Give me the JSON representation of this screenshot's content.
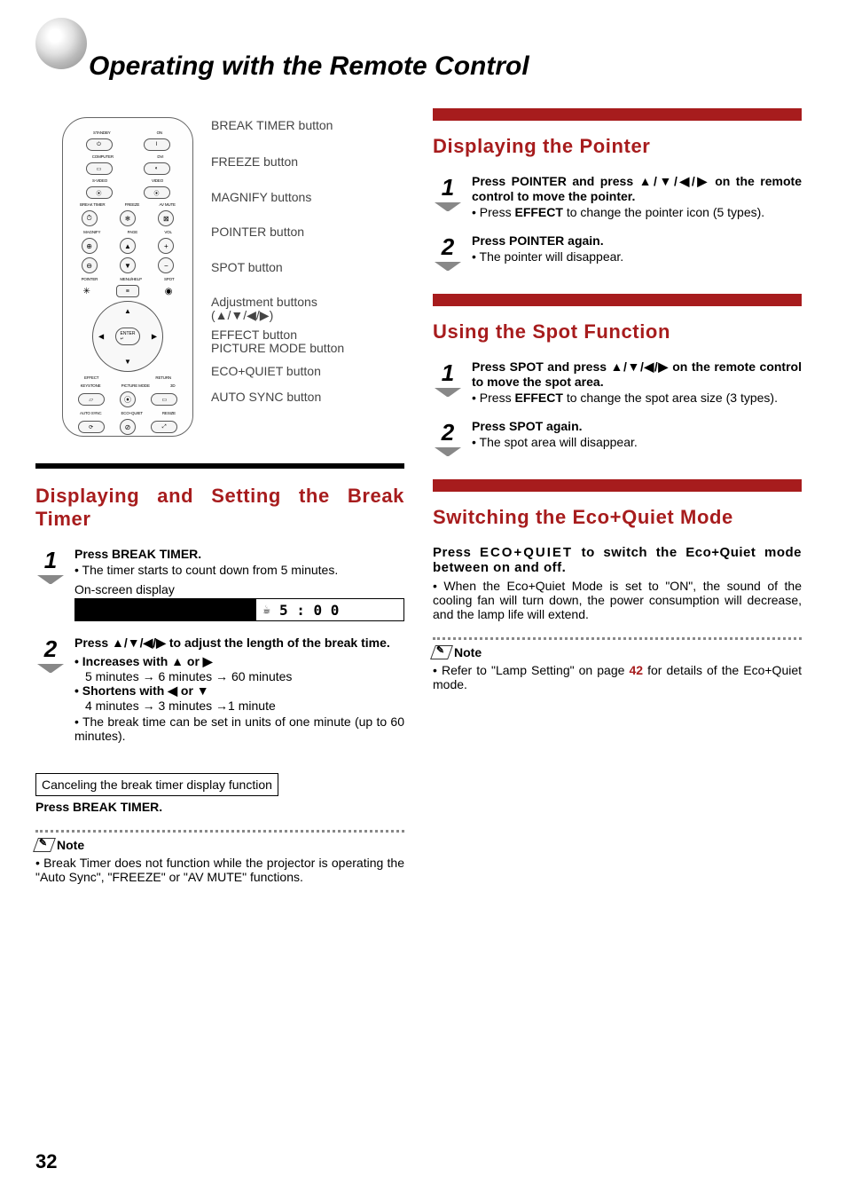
{
  "page": {
    "title": "Operating with the Remote Control",
    "number": "32"
  },
  "callouts": {
    "c1": "BREAK TIMER button",
    "c2": "FREEZE button",
    "c3": "MAGNIFY buttons",
    "c4": "POINTER button",
    "c5": "SPOT button",
    "c6a": "Adjustment buttons",
    "c6b": "(▲/▼/◀/▶)",
    "c7": "EFFECT button",
    "c8": "PICTURE MODE button",
    "c9": "ECO+QUIET button",
    "c10": "AUTO SYNC button"
  },
  "sections": {
    "breakTimer": {
      "heading": "Displaying and Setting the Break Timer",
      "step1": {
        "head_pre": "Press ",
        "head_btn": "BREAK TIMER",
        "head_post": ".",
        "b1": "The timer starts to count down from 5 minutes.",
        "osd_label": "On-screen display",
        "osd_value": "5 : 0 0"
      },
      "step2": {
        "head": "Press ▲/▼/◀/▶ to adjust the length of the break time.",
        "inc_head": "Increases with ▲ or ▶",
        "inc_detail": "5 minutes → 6 minutes → 60 minutes",
        "dec_head": "Shortens with ◀ or ▼",
        "dec_detail": "4 minutes → 3 minutes →1 minute",
        "b3": "The break time can be set in units of one minute (up to 60 minutes)."
      },
      "cancel_box": "Canceling the break timer display function",
      "cancel_press_pre": "Press ",
      "cancel_press_btn": "BREAK TIMER",
      "cancel_press_post": ".",
      "note_label": "Note",
      "note_body": "Break Timer does not function while the projector is operating the \"Auto Sync\", \"FREEZE\" or \"AV MUTE\" functions."
    },
    "pointer": {
      "heading": "Displaying the Pointer",
      "step1": {
        "head_a": "Press ",
        "head_b": "POINTER",
        "head_c": " and press ▲/▼/◀/▶ on the remote control to move the pointer.",
        "b1_a": "Press ",
        "b1_b": "EFFECT",
        "b1_c": " to change the pointer icon (5 types)."
      },
      "step2": {
        "head_a": "Press ",
        "head_b": "POINTER",
        "head_c": " again.",
        "b1": "The pointer will disappear."
      }
    },
    "spot": {
      "heading": "Using the Spot Function",
      "step1": {
        "head_a": "Press ",
        "head_b": "SPOT",
        "head_c": " and press ▲/▼/◀/▶ on the remote control to move the spot area.",
        "b1_a": "Press ",
        "b1_b": "EFFECT",
        "b1_c": " to change the spot area size (3 types)."
      },
      "step2": {
        "head_a": "Press ",
        "head_b": "SPOT",
        "head_c": " again.",
        "b1": "The spot area will disappear."
      }
    },
    "eco": {
      "heading": "Switching the Eco+Quiet Mode",
      "press_a": "Press ",
      "press_b": "ECO+QUIET",
      "press_c": " to switch the Eco+Quiet mode between on and off.",
      "desc": "When the Eco+Quiet Mode is set to \"ON\", the sound of the cooling fan will turn down, the power consumption will decrease, and the lamp life will extend.",
      "note_label": "Note",
      "note_a": "Refer to \"Lamp Setting\" on page ",
      "note_page": "42",
      "note_b": " for details of the Eco+Quiet mode."
    }
  }
}
